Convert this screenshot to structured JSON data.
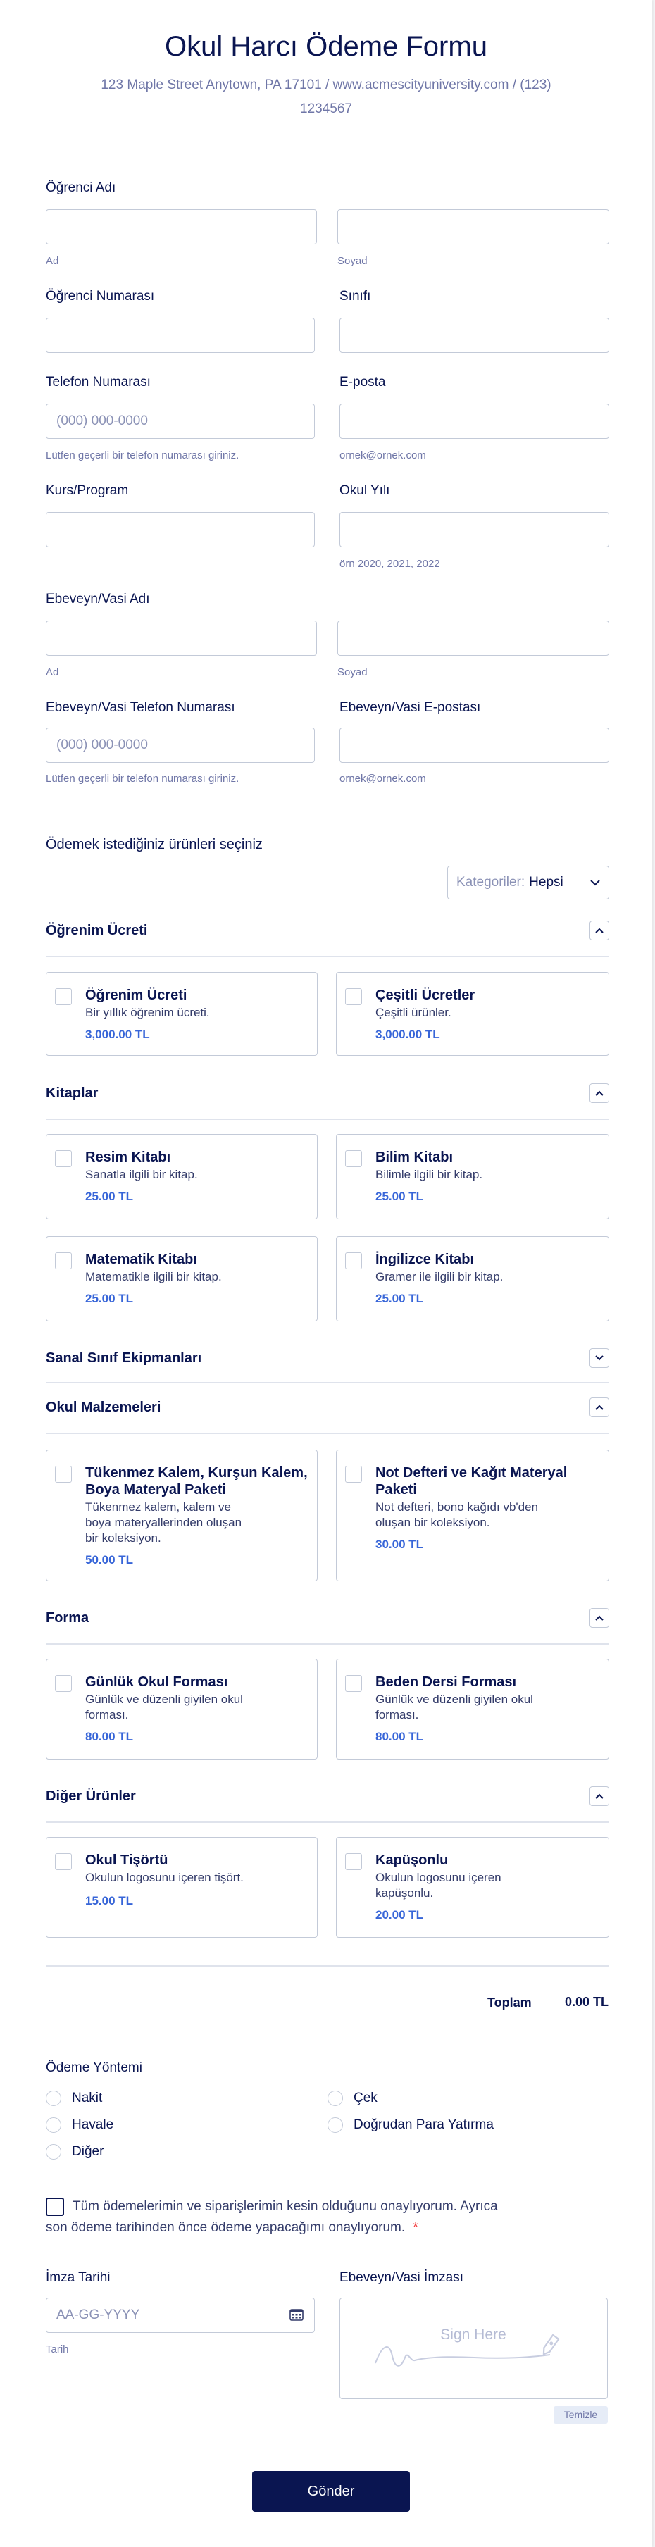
{
  "form": {
    "title": "Okul Harcı Ödeme Formu",
    "subtitle_line1": "123 Maple Street Anytown, PA 17101 / www.acmescityuniversity.com / (123)",
    "subtitle_line2": "1234567"
  },
  "fields": {
    "student_name_label": "Öğrenci Adı",
    "first_sub": "Ad",
    "last_sub": "Soyad",
    "student_number_label": "Öğrenci Numarası",
    "class_label": "Sınıfı",
    "phone_label": "Telefon Numarası",
    "phone_placeholder": "(000) 000-0000",
    "phone_help": "Lütfen geçerli bir telefon numarası giriniz.",
    "email_label": "E-posta",
    "email_help": "ornek@ornek.com",
    "course_label": "Kurs/Program",
    "school_year_label": "Okul Yılı",
    "school_year_help": "örn 2020, 2021, 2022",
    "parent_name_label": "Ebeveyn/Vasi Adı",
    "parent_first_sub": "Ad",
    "parent_last_sub": "Soyad",
    "parent_phone_label": "Ebeveyn/Vasi Telefon Numarası",
    "parent_phone_placeholder": "(000) 000-0000",
    "parent_phone_help": "Lütfen geçerli bir telefon numarası giriniz.",
    "parent_email_label": "Ebeveyn/Vasi E-postası",
    "parent_email_help": "ornek@ornek.com"
  },
  "products": {
    "heading": "Ödemek istediğiniz ürünleri seçiniz",
    "filter_prefix": "Kategoriler:",
    "filter_value": "Hepsi",
    "sections": {
      "tuition": "Öğrenim Ücreti",
      "books": "Kitaplar",
      "virtual": "Sanal Sınıf Ekipmanları",
      "supplies": "Okul Malzemeleri",
      "uniform": "Forma",
      "other": "Diğer Ürünler"
    },
    "items": [
      {
        "name": "Öğrenim Ücreti",
        "desc1": "Bir yıllık öğrenim ücreti.",
        "desc2": "",
        "desc3": "",
        "price": "3,000.00 TL"
      },
      {
        "name": "Çeşitli Ücretler",
        "desc1": "Çeşitli ürünler.",
        "desc2": "",
        "desc3": "",
        "price": "3,000.00 TL"
      },
      {
        "name": "Resim Kitabı",
        "desc1": "Sanatla ilgili bir kitap.",
        "price": "25.00 TL"
      },
      {
        "name": "Bilim Kitabı",
        "desc1": "Bilimle ilgili bir kitap.",
        "price": "25.00 TL"
      },
      {
        "name": "Matematik Kitabı",
        "desc1": "Matematikle ilgili bir kitap.",
        "price": "25.00 TL"
      },
      {
        "name": "İngilizce Kitabı",
        "desc1": "Gramer ile ilgili bir kitap.",
        "price": "25.00 TL"
      },
      {
        "name1": "Tükenmez Kalem, Kurşun Kalem,",
        "name2": "Boya Materyal Paketi",
        "desc1": "Tükenmez kalem, kalem ve",
        "desc2": "boya materyallerinden oluşan",
        "desc3": "bir koleksiyon.",
        "price": "50.00 TL"
      },
      {
        "name1": "Not Defteri ve Kağıt Materyal",
        "name2": "Paketi",
        "desc1": "Not defteri, bono kağıdı vb'den",
        "desc2": "oluşan bir koleksiyon.",
        "price": "30.00 TL"
      },
      {
        "name": "Günlük Okul Forması",
        "desc1": "Günlük ve düzenli giyilen okul",
        "desc2": "forması.",
        "price": "80.00 TL"
      },
      {
        "name": "Beden Dersi Forması",
        "desc1": "Günlük ve düzenli giyilen okul",
        "desc2": "forması.",
        "price": "80.00 TL"
      },
      {
        "name": "Okul Tişörtü",
        "desc1": "Okulun logosunu içeren tişört.",
        "price": "15.00 TL"
      },
      {
        "name": "Kapüşonlu",
        "desc1": "Okulun logosunu içeren",
        "desc2": "kapüşonlu.",
        "price": "20.00 TL"
      }
    ],
    "total_label": "Toplam",
    "total_value": "0.00 TL"
  },
  "payment": {
    "label": "Ödeme Yöntemi",
    "options": [
      "Nakit",
      "Çek",
      "Havale",
      "Doğrudan Para Yatırma",
      "Diğer"
    ]
  },
  "confirm": {
    "line1": "Tüm ödemelerimin ve siparişlerimin kesin olduğunu onaylıyorum. Ayrıca",
    "line2": "son ödeme tarihinden önce ödeme yapacağımı onaylıyorum.",
    "required_mark": "*"
  },
  "signature": {
    "date_label": "İmza Tarihi",
    "date_placeholder": "AA-GG-YYYY",
    "date_sub": "Tarih",
    "sign_label": "Ebeveyn/Vasi İmzası",
    "sign_here": "Sign Here",
    "clear": "Temizle"
  },
  "submit_label": "Gönder",
  "colors": {
    "primary": "#0a1551",
    "accent": "#3765d8",
    "border": "#c3cad8",
    "muted": "#6f76a7",
    "required": "#f23a3c"
  }
}
